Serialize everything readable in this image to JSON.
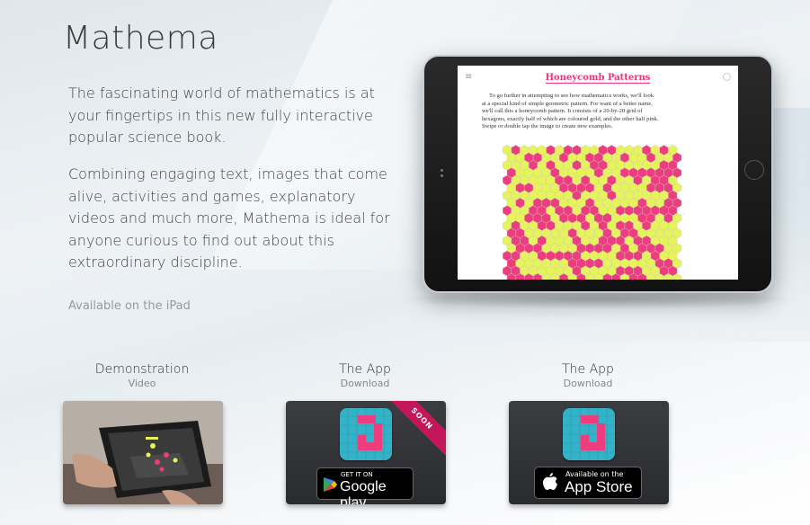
{
  "header": {
    "title": "Mathema"
  },
  "intro": {
    "paragraph1": "The fascinating world of mathematics is at your fingertips in this new fully interactive popular science book.",
    "paragraph2": "Combining engaging text, images that come alive, activities and games, explanatory videos and much more, Mathema is ideal for anyone curious to find out about this extraordinary discipline.",
    "availability": "Available on the iPad"
  },
  "tablet_screen": {
    "title": "Honeycomb Patterns",
    "body_lines": [
      "To go further in attempting to see how mathematics works, we'll look",
      "at a special kind of simple geometric pattern. For want of a better name,",
      "we'll call this a honeycomb pattern. It consists of a 20-by-20 grid of",
      "hexagons, exactly half of which are coloured gold, and the other half pink.",
      "Swipe or double tap the image to create new examples."
    ],
    "colors": {
      "gold": "#e6f35a",
      "pink": "#ec3d7e"
    }
  },
  "cards": [
    {
      "title": "Demonstration",
      "subtitle": "Video",
      "icon": "video-thumbnail"
    },
    {
      "title": "The App",
      "subtitle": "Download",
      "ribbon": "SOON",
      "badge_small": "GET IT ON",
      "badge_large": "Google play",
      "icon": "google-play-icon"
    },
    {
      "title": "The App",
      "subtitle": "Download",
      "badge_small": "Available on the",
      "badge_large": "App Store",
      "icon": "apple-icon"
    }
  ]
}
